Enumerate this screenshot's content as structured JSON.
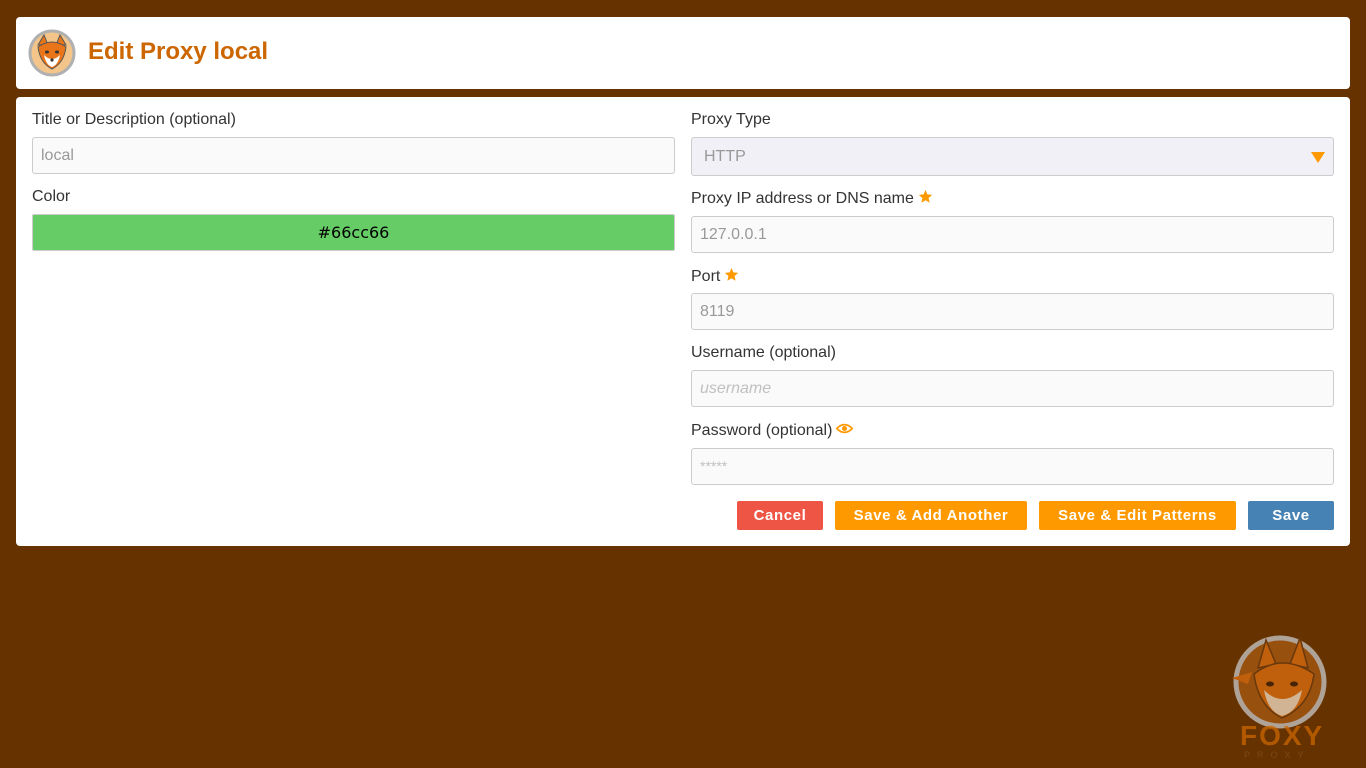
{
  "header": {
    "title": "Edit Proxy local"
  },
  "form": {
    "title_label": "Title or Description (optional)",
    "title_value": "local",
    "color_label": "Color",
    "color_value": "#66cc66",
    "proxy_type_label": "Proxy Type",
    "proxy_type_value": "HTTP",
    "ip_label": "Proxy IP address or DNS name",
    "ip_value": "127.0.0.1",
    "port_label": "Port",
    "port_value": "8119",
    "username_label": "Username (optional)",
    "username_placeholder": "username",
    "password_label": "Password (optional)",
    "password_placeholder": "*****"
  },
  "buttons": {
    "cancel": "Cancel",
    "save_add_another": "Save & Add Another",
    "save_edit_patterns": "Save & Edit Patterns",
    "save": "Save"
  },
  "colors": {
    "background": "#663300",
    "accent": "#cc6600",
    "orange": "#ff9900",
    "cancel": "#ee5544",
    "save": "#4682b4",
    "proxy_color": "#66cc66"
  },
  "icons": {
    "logo": "foxyproxy-logo",
    "required": "star-icon",
    "reveal": "eye-icon",
    "dropdown": "triangle-down-icon"
  },
  "watermark": {
    "text": "FOXY",
    "subtext": "PROXY"
  }
}
